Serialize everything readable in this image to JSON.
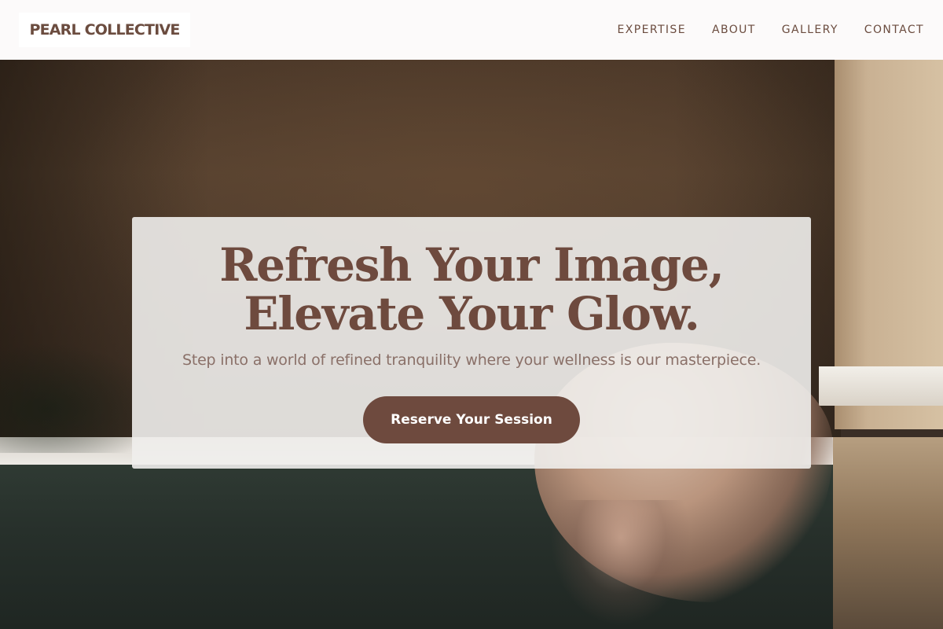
{
  "header": {
    "logo": "PEARL COLLECTIVE",
    "nav": [
      {
        "label": "EXPERTISE"
      },
      {
        "label": "ABOUT"
      },
      {
        "label": "GALLERY"
      },
      {
        "label": "CONTACT"
      }
    ]
  },
  "hero": {
    "headline": "Refresh Your Image, Elevate Your Glow.",
    "subline": "Step into a world of refined tranquility where your wellness is our masterpiece.",
    "cta_label": "Reserve Your Session"
  },
  "colors": {
    "brand_brown": "#6e4a3e",
    "header_bg": "#fcfafa",
    "card_bg": "#f0eeec"
  }
}
